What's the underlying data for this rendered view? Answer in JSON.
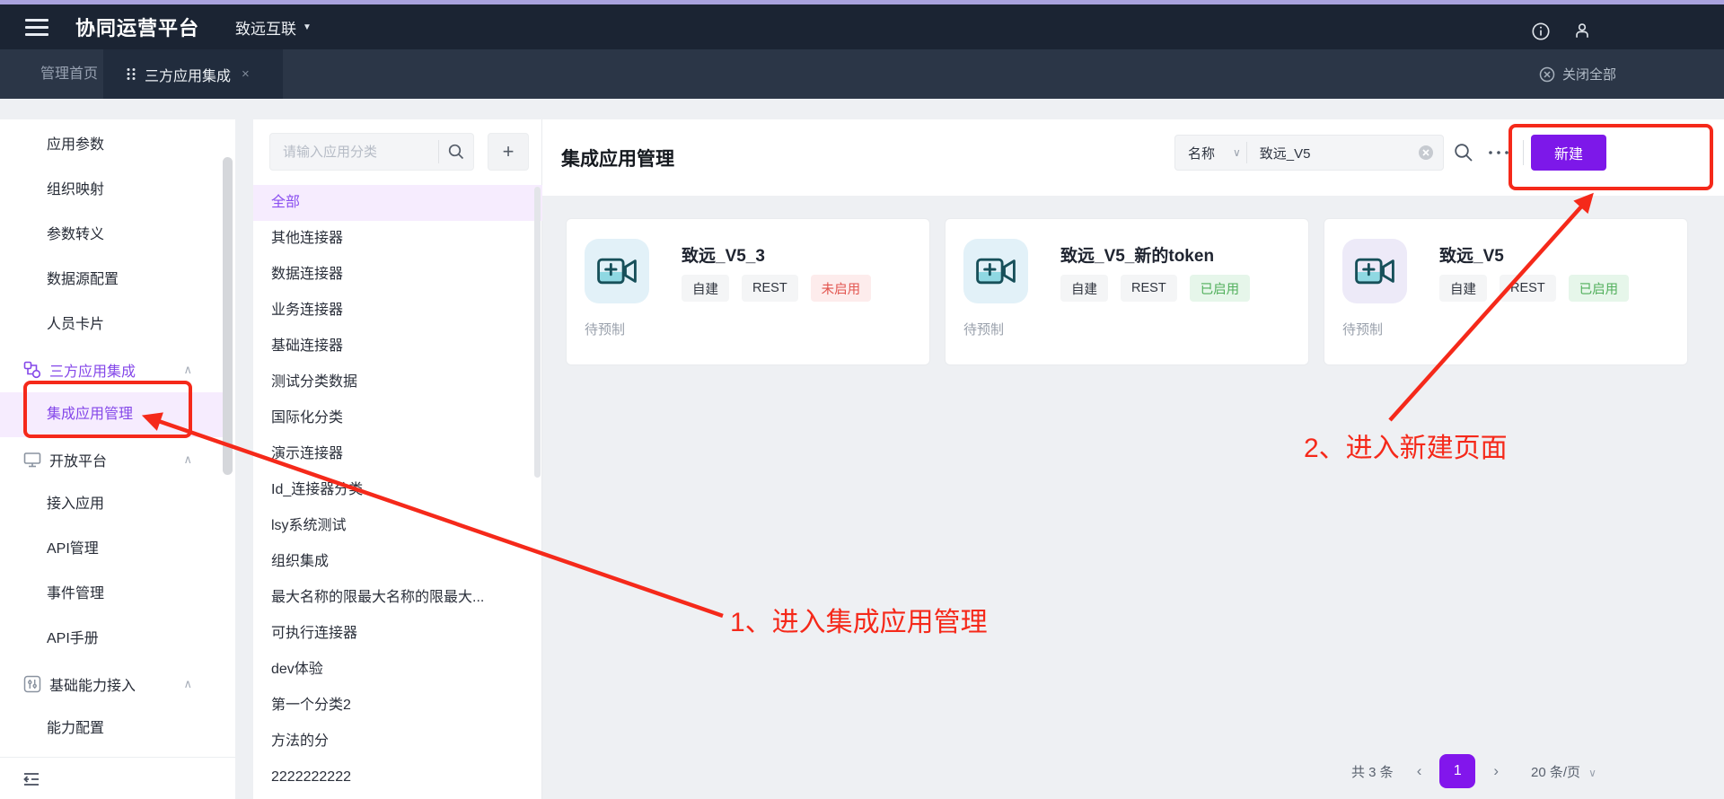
{
  "colors": {
    "accent_purple": "#7d18e9",
    "sidebar_active_purple": "#8447e9",
    "annotation_red": "#f5291a",
    "status_red": "#e2554f",
    "status_green": "#50af5b",
    "topbar_bg": "#1b2433",
    "tabbar_bg": "#2b3647"
  },
  "icons": {
    "hamburger": "menu-lines",
    "caret_down": "▼",
    "info": "circle-i",
    "user": "person",
    "tab_grid": "six-dots",
    "tab_close": "×",
    "close_all": "circle-x",
    "chevron_up": "∧",
    "chevron_down": "∨",
    "chevron_left": "‹",
    "chevron_right": "›",
    "search": "magnifier",
    "plus": "+",
    "clear": "circle-x-filled",
    "more": "⋯",
    "org_chart": "connected-nodes",
    "monitor": "display",
    "sliders": "adjusters",
    "collapse": "indent-left",
    "camera_plus": "video-camera-plus"
  },
  "topbar": {
    "title": "协同运营平台",
    "tenant": "致远互联"
  },
  "tabbar": {
    "home": "管理首页",
    "active": "三方应用集成",
    "close_all": "关闭全部"
  },
  "sidebar": {
    "items": [
      "应用参数",
      "组织映射",
      "参数转义",
      "数据源配置",
      "人员卡片",
      "三方应用集成",
      "集成应用管理",
      "开放平台",
      "接入应用",
      "API管理",
      "事件管理",
      "API手册",
      "基础能力接入",
      "能力配置"
    ]
  },
  "categories": {
    "search_placeholder": "请输入应用分类",
    "items": [
      "全部",
      "其他连接器",
      "数据连接器",
      "业务连接器",
      "基础连接器",
      "测试分类数据",
      "国际化分类",
      "演示连接器",
      "Id_连接器分类",
      "lsy系统测试",
      "组织集成",
      "最大名称的限最大名称的限最大...",
      "可执行连接器",
      "dev体验",
      "第一个分类2",
      "方法的分",
      "2222222222"
    ]
  },
  "header": {
    "title": "集成应用管理",
    "filter_field": "名称",
    "search_value": "致远_V5",
    "new_button": "新建"
  },
  "cards": [
    {
      "title": "致远_V5_3",
      "tags": [
        "自建",
        "REST"
      ],
      "status": "未启用",
      "footer": "待预制"
    },
    {
      "title": "致远_V5_新的token",
      "tags": [
        "自建",
        "REST"
      ],
      "status": "已启用",
      "footer": "待预制"
    },
    {
      "title": "致远_V5",
      "tags": [
        "自建",
        "REST"
      ],
      "status": "已启用",
      "footer": "待预制"
    }
  ],
  "annotations": {
    "step1": "1、进入集成应用管理",
    "step2": "2、进入新建页面"
  },
  "pagination": {
    "total": "共 3 条",
    "page": "1",
    "page_size": "20 条/页"
  }
}
